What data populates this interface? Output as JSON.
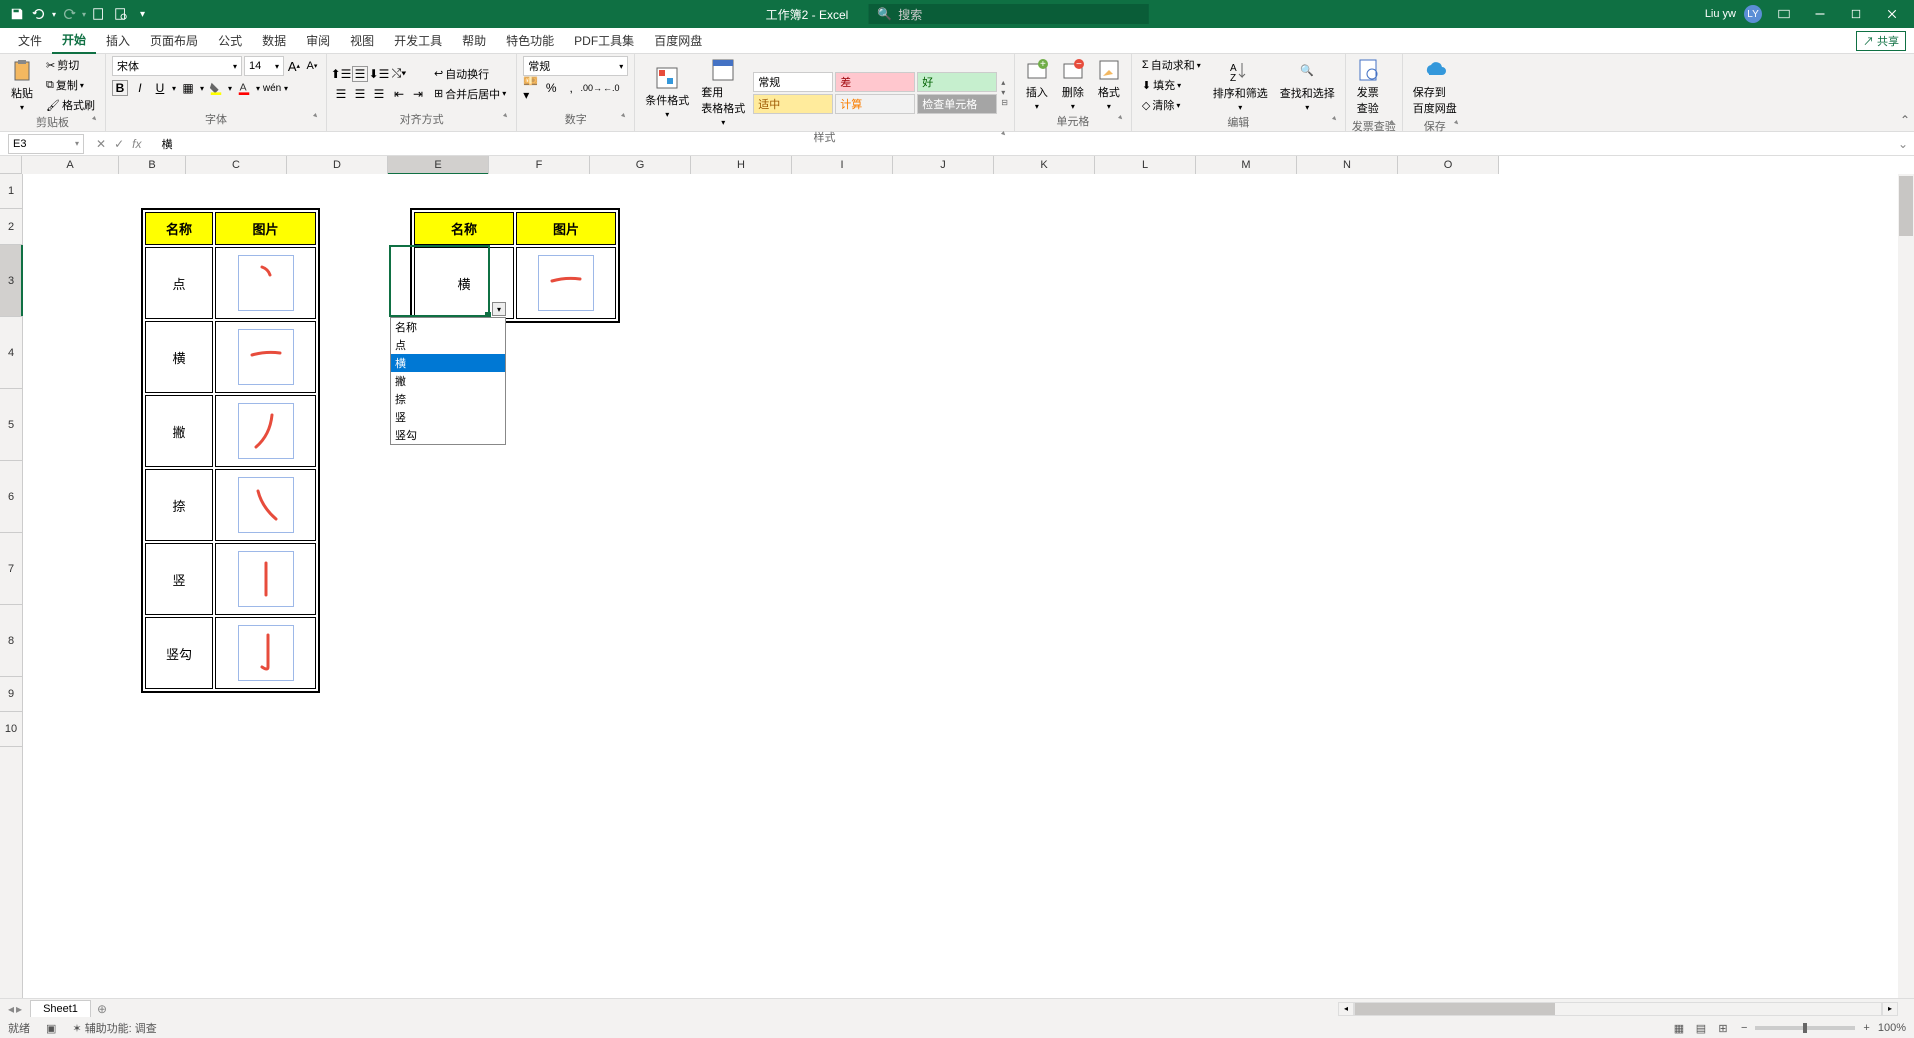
{
  "titlebar": {
    "title": "工作簿2 - Excel",
    "search_placeholder": "搜索",
    "user_name": "Liu yw",
    "user_initials": "LY"
  },
  "tabs": {
    "items": [
      "文件",
      "开始",
      "插入",
      "页面布局",
      "公式",
      "数据",
      "审阅",
      "视图",
      "开发工具",
      "帮助",
      "特色功能",
      "PDF工具集",
      "百度网盘"
    ],
    "active": "开始",
    "share": "共享"
  },
  "ribbon": {
    "clipboard": {
      "label": "剪贴板",
      "paste": "粘贴",
      "cut": "剪切",
      "copy": "复制",
      "format_painter": "格式刷"
    },
    "font": {
      "label": "字体",
      "name": "宋体",
      "size": "14"
    },
    "alignment": {
      "label": "对齐方式",
      "wrap": "自动换行",
      "merge": "合并后居中"
    },
    "number": {
      "label": "数字",
      "format": "常规"
    },
    "styles": {
      "label": "样式",
      "cond_format": "条件格式",
      "table_format": "套用\n表格格式",
      "normal": "常规",
      "bad": "差",
      "good": "好",
      "neutral": "适中",
      "calc": "计算",
      "check": "检查单元格"
    },
    "cells": {
      "label": "单元格",
      "insert": "插入",
      "delete": "删除",
      "format": "格式"
    },
    "editing": {
      "label": "编辑",
      "autosum": "自动求和",
      "fill": "填充",
      "clear": "清除",
      "sort": "排序和筛选",
      "find": "查找和选择"
    },
    "invoice": {
      "label": "发票查验",
      "btn": "发票\n查验"
    },
    "save": {
      "label": "保存",
      "btn": "保存到\n百度网盘"
    }
  },
  "formula_bar": {
    "name_box": "E3",
    "formula": "横"
  },
  "table1": {
    "headers": {
      "name": "名称",
      "image": "图片"
    },
    "rows": [
      {
        "name": "点"
      },
      {
        "name": "横"
      },
      {
        "name": "撇"
      },
      {
        "name": "捺"
      },
      {
        "name": "竖"
      },
      {
        "name": "竖勾"
      }
    ]
  },
  "table2": {
    "headers": {
      "name": "名称",
      "image": "图片"
    },
    "cell_value": "横"
  },
  "dropdown": {
    "items": [
      "名称",
      "点",
      "横",
      "撇",
      "捺",
      "竖",
      "竖勾"
    ],
    "highlighted_index": 2
  },
  "columns": [
    "A",
    "B",
    "C",
    "D",
    "E",
    "F",
    "G",
    "H",
    "I",
    "J",
    "K",
    "L",
    "M",
    "N",
    "O"
  ],
  "sheet": {
    "active": "Sheet1"
  },
  "status": {
    "ready": "就绪",
    "accessibility": "辅助功能: 调查",
    "zoom": "100%"
  }
}
